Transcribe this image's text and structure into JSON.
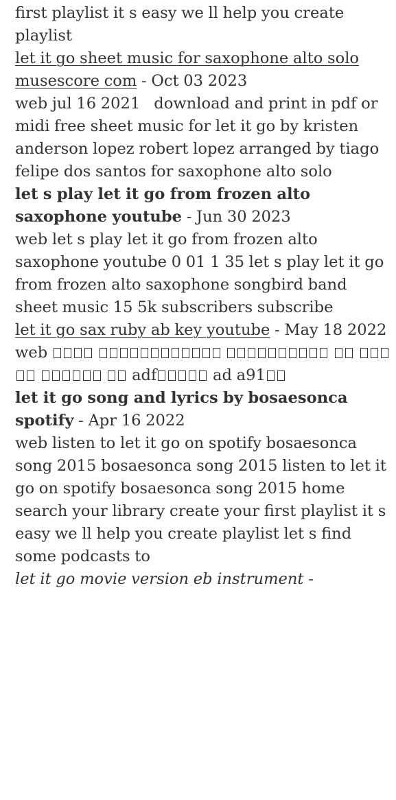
{
  "intro": {
    "text": "first playlist it s easy we ll help you create playlist"
  },
  "entries": [
    {
      "title": "let it go sheet music for saxophone alto solo musescore com",
      "separator": " - ",
      "date": "Oct 03 2023",
      "body": "web jul 16 2021   download and print in pdf or midi free sheet music for let it go by kristen anderson lopez robert lopez arranged by tiago felipe dos santos for saxophone alto solo"
    },
    {
      "title": "let s play let it go from frozen alto saxophone youtube",
      "separator": " - ",
      "date": "Jun 30 2023",
      "body": "web let s play let it go from frozen alto saxophone youtube 0 01 1 35 let s play let it go from frozen alto saxophone songbird band sheet music 15 5k subscribers subscribe"
    },
    {
      "title": "let it go sax ruby ab key youtube",
      "separator": " - ",
      "date": "May 18 2022",
      "body_prefix": "web",
      "body_mid1": "adf",
      "body_mid2": "ad a91"
    },
    {
      "title": "let it go song and lyrics by bosaesonca spotify",
      "separator": " - ",
      "date": "Apr 16 2022",
      "body": "web listen to let it go on spotify bosaesonca song 2015 bosaesonca song 2015 listen to let it go on spotify bosaesonca song 2015 home search your library create your first playlist it s easy we ll help you create playlist let s find some podcasts to"
    },
    {
      "title": "let it go movie version eb instrument",
      "separator": " -"
    }
  ]
}
